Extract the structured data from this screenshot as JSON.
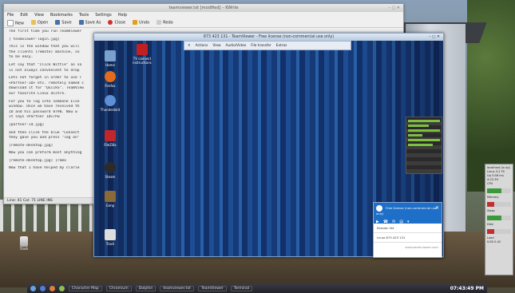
{
  "kwrite": {
    "title": "teamviewer.txt [modified] – KWrite",
    "menu": [
      "File",
      "Edit",
      "View",
      "Bookmarks",
      "Tools",
      "Settings",
      "Help"
    ],
    "toolbar": [
      "New",
      "Open",
      "Save",
      "Save As",
      "Close",
      "Undo",
      "Redo"
    ],
    "text_lines": [
      "The first time you run TeamViewer",
      "[ teamviewer-login.jpg]",
      "This is the window that you will",
      "the clients (remote) machine, so",
      "to be easy.",
      "Let say that \"click Wittle\" as so",
      "is not always convenient to drop",
      "Lets not forget in order to use T",
      "<Partner-ID> etc. remotely named c",
      "download it for \"QuickS\". TeamView",
      "our favorite Linux distro.",
      "For you to log into someone Else",
      "window. Once we have received th",
      "ID and his password 8790. Now w",
      "it says <Partner ID>/Pw",
      "[partner-id.jpg]",
      "and then click the blue \"Connect",
      "they gave you and press \"log on\"",
      "[remote-desktop.jpg]",
      "Now you can preform most anything",
      "[remote-desktop.jpg]        [remo",
      "Now that I have helped my clarie"
    ],
    "status": "Line: 41 Col: 71    LINE   INS"
  },
  "teamviewer": {
    "title": "873 423 131 - TeamViewer - Free license (non-commercial use only)",
    "toolbar": [
      "Actions",
      "View",
      "Audio/Video",
      "File transfer",
      "Extras"
    ],
    "desktop_icons": [
      {
        "label": "Home",
        "color": "#7aa0d0"
      },
      {
        "label": "Firefox",
        "color": "#e36b1e"
      },
      {
        "label": "Thunderbird",
        "color": "#5f8fd4"
      },
      {
        "label": "FileZilla",
        "color": "#c0272d"
      },
      {
        "label": "Steam",
        "color": "#2b2b2b"
      },
      {
        "label": "Gimp",
        "color": "#8a6a3a"
      },
      {
        "label": "Trash",
        "color": "#dddddd"
      }
    ],
    "remote_file_icon": "TV connect instructions",
    "popup": {
      "title": "Free license (non-commercial use only)",
      "session_label": "Session list",
      "session_id": "Linux 873 423 131",
      "footer": "www.teamviewer.com"
    }
  },
  "monitor": {
    "lines": [
      "localhost (lo up)",
      "Linux 3.2 FS",
      "Up 3:56 hrs",
      "4:22:39",
      "CPU",
      "Memory",
      "Swap",
      "Disk",
      "Load",
      "0.80 0.42"
    ]
  },
  "desktop": {
    "trash_label": "Trash"
  },
  "taskbar": {
    "tasks": [
      "Character Map",
      "Chromium",
      "Dolphin",
      "teamviewer.txt",
      "TeamViewer",
      "Terminal"
    ],
    "clock": "07:43:49 PM"
  }
}
